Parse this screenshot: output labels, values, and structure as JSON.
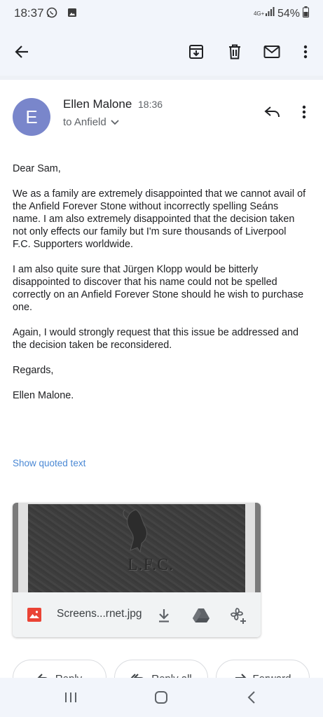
{
  "status_bar": {
    "time": "18:37",
    "network": "4G+",
    "battery": "54%",
    "icons": [
      "whatsapp-icon",
      "gallery-icon",
      "signal-icon",
      "battery-icon"
    ]
  },
  "app_bar": {
    "icons": [
      "back-arrow-icon",
      "archive-icon",
      "delete-icon",
      "mark-unread-icon",
      "more-vert-icon"
    ]
  },
  "email": {
    "avatar_letter": "E",
    "avatar_color": "#7986cb",
    "sender": "Ellen Malone",
    "time": "18:36",
    "recipient": "to Anfield",
    "body": [
      "Dear Sam,",
      "We as a family are extremely disappointed that we cannot avail of the Anfield Forever Stone without incorrectly spelling Seáns name. I am also extremely disappointed that the decision taken not only effects our family but I'm sure thousands of Liverpool F.C. Supporters worldwide.",
      "I am also quite sure that Jürgen Klopp would be bitterly disappointed to discover that his name could not be spelled correctly on an Anfield Forever Stone should he wish to purchase one.",
      "Again, I would strongly request that this issue be addressed and the decision taken be reconsidered.",
      "Regards,",
      "Ellen Malone."
    ],
    "show_quoted": "Show quoted text",
    "link_color": "#4a88d4"
  },
  "attachment": {
    "stone_engraving": "L.F.C.",
    "filename": "Screens...rnet.jpg",
    "actions": [
      "download-icon",
      "drive-icon",
      "add-to-photos-icon"
    ]
  },
  "actions": {
    "reply": "Reply",
    "reply_all": "Reply all",
    "forward": "Forward"
  },
  "nav": {
    "icons": [
      "recents-icon",
      "home-icon",
      "back-icon"
    ]
  }
}
